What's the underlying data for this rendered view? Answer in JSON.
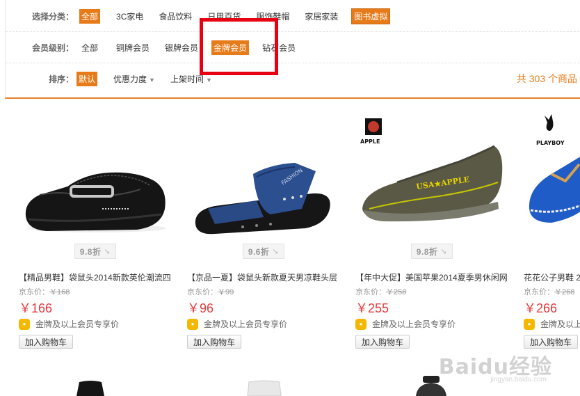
{
  "filters": {
    "category": {
      "label": "选择分类：",
      "items": [
        "全部",
        "3C家电",
        "食品饮料",
        "日用百货",
        "服饰鞋帽",
        "家居家装",
        "图书虚拟"
      ]
    },
    "member_level": {
      "label": "会员级别：",
      "items": [
        "全部",
        "铜牌会员",
        "银牌会员",
        "金牌会员",
        "钻石会员"
      ]
    },
    "sort": {
      "label": "排序：",
      "items": [
        "默认",
        "优惠力度",
        "上架时间"
      ]
    },
    "total_text": "共 303 个商品",
    "total_cut": "1"
  },
  "products": [
    {
      "discount": "9.8折",
      "title": "【精品男鞋】袋鼠头2014新款英伦潮流四",
      "jd_price_label": "京东价：",
      "jd_price": "￥168",
      "price": "￥166",
      "member_text": "金牌及以上会员专享价",
      "cart_label": "加入购物车"
    },
    {
      "discount": "9.6折",
      "title": "【京品一夏】袋鼠头新款夏天男凉鞋头层",
      "jd_price_label": "京东价：",
      "jd_price": "￥99",
      "price": "￥96",
      "member_text": "金牌及以上会员专享价",
      "cart_label": "加入购物车",
      "strap_text": "FASHION"
    },
    {
      "discount": "9.8折",
      "brand": "APPLE",
      "title": "【年中大促】美国苹果2014夏季男休闲网",
      "jd_price_label": "京东价：",
      "jd_price": "￥258",
      "price": "￥255",
      "member_text": "金牌及以上会员专享价",
      "cart_label": "加入购物车",
      "shoe_text": "USA★APPLE"
    },
    {
      "brand": "PLAYBOY",
      "title": "花花公子男鞋 2",
      "jd_price_label": "京东价：",
      "jd_price": "￥268",
      "price": "￥266",
      "member_text": "金牌及以上会员专享价",
      "cart_label": "加入购物车"
    }
  ],
  "watermark": "Baidu经验",
  "watermark_url": "jingyan.baidu.com",
  "colors": {
    "accent": "#e77b1a",
    "price": "#e4393c",
    "highlight_box": "#e60012"
  }
}
